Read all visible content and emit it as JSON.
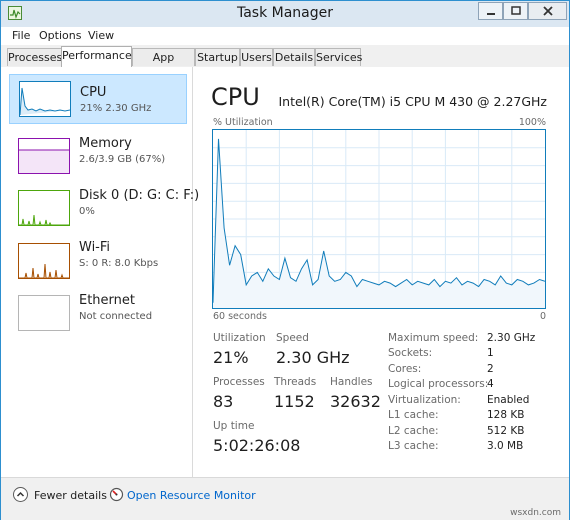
{
  "window": {
    "title": "Task Manager"
  },
  "menu": [
    "File",
    "Options",
    "View"
  ],
  "tabs": [
    "Processes",
    "Performance",
    "App history",
    "Startup",
    "Users",
    "Details",
    "Services"
  ],
  "resources": [
    {
      "name": "CPU",
      "detail": "21% 2.30 GHz"
    },
    {
      "name": "Memory",
      "detail": "2.6/3.9 GB (67%)"
    },
    {
      "name": "Disk 0 (D: G: C: F:)",
      "detail": "0%"
    },
    {
      "name": "Wi-Fi",
      "detail": "S: 0 R: 8.0 Kbps"
    },
    {
      "name": "Ethernet",
      "detail": "Not connected"
    }
  ],
  "cpu": {
    "title": "CPU",
    "model": "Intel(R) Core(TM) i5 CPU M 430 @ 2.27GHz",
    "y_label": "% Utilization",
    "y_max_label": "100%",
    "x_left_label": "60 seconds",
    "x_right_label": "0"
  },
  "stats": {
    "utilization_label": "Utilization",
    "utilization": "21%",
    "speed_label": "Speed",
    "speed": "2.30 GHz",
    "processes_label": "Processes",
    "processes": "83",
    "threads_label": "Threads",
    "threads": "1152",
    "handles_label": "Handles",
    "handles": "32632",
    "uptime_label": "Up time",
    "uptime": "5:02:26:08"
  },
  "specs": [
    {
      "label": "Maximum speed:",
      "value": "2.30 GHz"
    },
    {
      "label": "Sockets:",
      "value": "1"
    },
    {
      "label": "Cores:",
      "value": "2"
    },
    {
      "label": "Logical processors:",
      "value": "4"
    },
    {
      "label": "Virtualization:",
      "value": "Enabled"
    },
    {
      "label": "L1 cache:",
      "value": "128 KB"
    },
    {
      "label": "L2 cache:",
      "value": "512 KB"
    },
    {
      "label": "L3 cache:",
      "value": "3.0 MB"
    }
  ],
  "footer": {
    "fewer_details": "Fewer details",
    "open_monitor": "Open Resource Monitor"
  },
  "watermark": "wsxdn.com",
  "colors": {
    "cpu": "#117dbb",
    "memory": "#8b12ae",
    "disk": "#4da60c",
    "wifi": "#a74f01",
    "link": "#0066cc",
    "selected": "#cce8ff"
  },
  "icons": {
    "app": "task-manager-icon",
    "collapse": "chevron-up-icon",
    "monitor": "resource-monitor-icon"
  },
  "chart_data": {
    "type": "area",
    "x_range": [
      60,
      0
    ],
    "ylim": [
      0,
      100
    ],
    "grid": true,
    "values": [
      3,
      95,
      45,
      24,
      35,
      30,
      13,
      18,
      20,
      15,
      22,
      18,
      16,
      28,
      17,
      15,
      22,
      27,
      13,
      16,
      32,
      18,
      15,
      16,
      20,
      18,
      12,
      16,
      15,
      14,
      13,
      15,
      14,
      12,
      14,
      16,
      13,
      15,
      14,
      13,
      16,
      12,
      15,
      14,
      17,
      13,
      15,
      14,
      12,
      16,
      15,
      13,
      18,
      14,
      13,
      16,
      15,
      13,
      14,
      16,
      15
    ]
  }
}
